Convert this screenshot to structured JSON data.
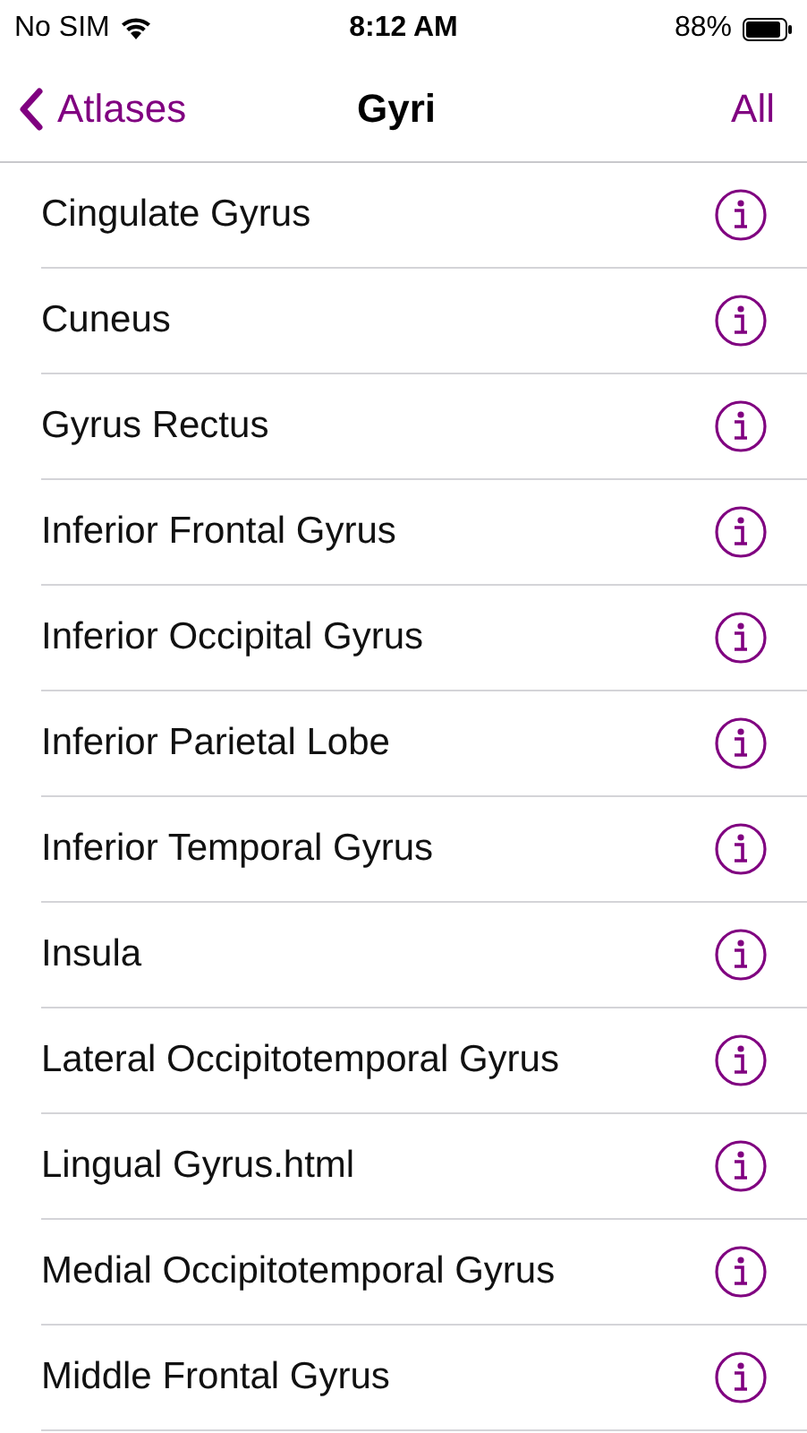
{
  "status_bar": {
    "carrier": "No SIM",
    "time": "8:12 AM",
    "battery": "88%"
  },
  "nav": {
    "back": "Atlases",
    "title": "Gyri",
    "action": "All"
  },
  "items": [
    {
      "label": "Cingulate Gyrus"
    },
    {
      "label": "Cuneus"
    },
    {
      "label": "Gyrus Rectus"
    },
    {
      "label": "Inferior Frontal Gyrus"
    },
    {
      "label": "Inferior Occipital Gyrus"
    },
    {
      "label": "Inferior Parietal Lobe"
    },
    {
      "label": "Inferior Temporal Gyrus"
    },
    {
      "label": "Insula"
    },
    {
      "label": "Lateral Occipitotemporal Gyrus"
    },
    {
      "label": "Lingual Gyrus.html"
    },
    {
      "label": "Medial Occipitotemporal Gyrus"
    },
    {
      "label": "Middle Frontal Gyrus"
    }
  ]
}
